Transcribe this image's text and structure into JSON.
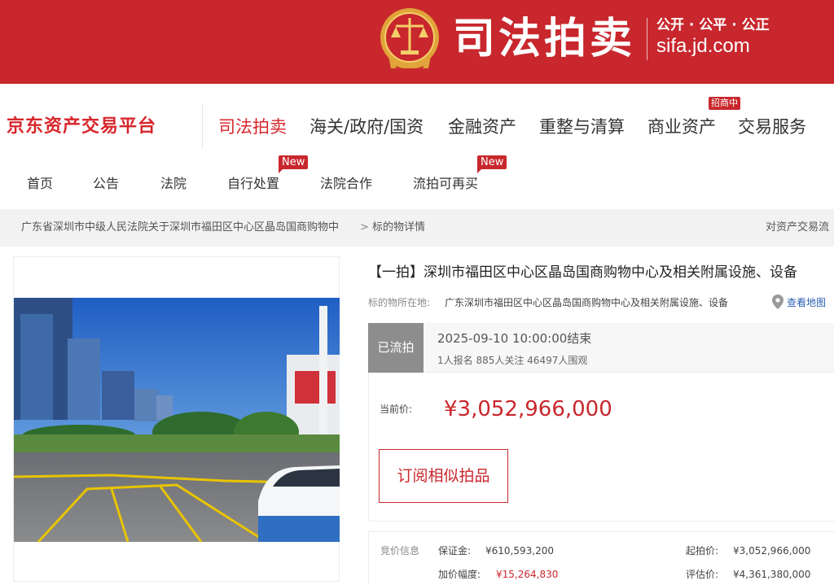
{
  "banner": {
    "title": "司法拍卖",
    "slogan": "公开 · 公平 · 公正",
    "domain": "sifa.jd.com"
  },
  "nav_main": {
    "logo": "京东资产交易平台",
    "items": [
      "司法拍卖",
      "海关/政府/国资",
      "金融资产",
      "重整与清算",
      "商业资产",
      "交易服务"
    ],
    "recruit_badge": "招商中"
  },
  "nav_sub": {
    "items": [
      "首页",
      "公告",
      "法院",
      "自行处置",
      "法院合作",
      "流拍可再买"
    ],
    "new_badge": "New"
  },
  "breadcrumb": {
    "court": "广东省深圳市中级人民法院关于深圳市福田区中心区晶岛国商购物中",
    "separator": ">",
    "current": "标的物详情",
    "right": "对资产交易流"
  },
  "item": {
    "title": "【一拍】深圳市福田区中心区晶岛国商购物中心及相关附属设施、设备",
    "location_label": "标的物所在地:",
    "location": "广东深圳市福田区中心区晶岛国商购物中心及相关附属设施、设备",
    "map_link": "查看地图"
  },
  "status": {
    "tag": "已流拍",
    "end_time": "2025-09-10 10:00:00结束",
    "stats": "1人报名  885人关注  46497人围观"
  },
  "price": {
    "label": "当前价:",
    "value": "¥3,052,966,000"
  },
  "subscribe_label": "订阅相似拍品",
  "bid_info": {
    "label": "竞价信息",
    "deposit_label": "保证金:",
    "deposit": "¥610,593,200",
    "start_price_label": "起拍价:",
    "start_price": "¥3,052,966,000",
    "increment_label": "加价幅度:",
    "increment": "¥15,264,830",
    "appraisal_label": "评估价:",
    "appraisal": "¥4,361,380,000"
  },
  "colors": {
    "brand_red": "#c8272d",
    "status_gray": "#8d8d8d",
    "link_blue": "#2a5fb3"
  }
}
